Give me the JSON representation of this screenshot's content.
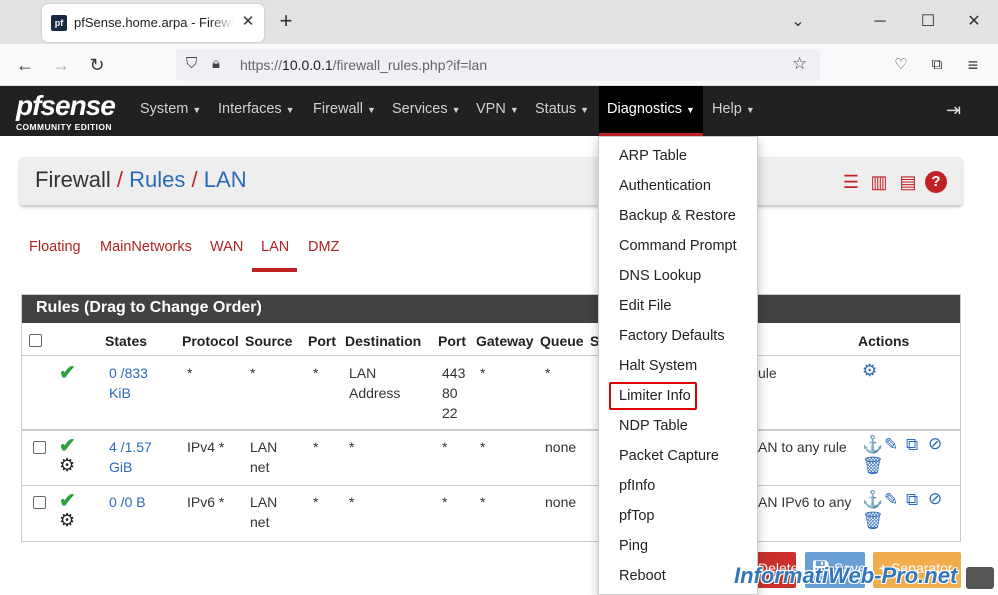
{
  "browser": {
    "tab_title": "pfSense.home.arpa - Firewall: Rules",
    "favicon_text": "pf",
    "url_prefix": "https://",
    "url_host": "10.0.0.1",
    "url_path": "/firewall_rules.php?if=lan"
  },
  "logo": {
    "main": "pfsense",
    "sub": "COMMUNITY EDITION"
  },
  "menu": [
    {
      "label": "System"
    },
    {
      "label": "Interfaces"
    },
    {
      "label": "Firewall"
    },
    {
      "label": "Services"
    },
    {
      "label": "VPN"
    },
    {
      "label": "Status"
    },
    {
      "label": "Diagnostics"
    },
    {
      "label": "Help"
    }
  ],
  "breadcrumb": {
    "part1": "Firewall",
    "sep": "/",
    "part2": "Rules",
    "part3": "LAN"
  },
  "subtabs": [
    "Floating",
    "MainNetworks",
    "WAN",
    "LAN",
    "DMZ"
  ],
  "panel_title": "Rules (Drag to Change Order)",
  "columns": [
    "States",
    "Protocol",
    "Source",
    "Port",
    "Destination",
    "Port",
    "Gateway",
    "Queue",
    "S",
    "Actions"
  ],
  "rows": [
    {
      "states1": "0 /833",
      "states2": "KiB",
      "protocol": "*",
      "source1": "*",
      "source2": "",
      "port": "*",
      "dest1": "LAN",
      "dest2": "Address",
      "dport1": "443",
      "dport2": "80",
      "dport3": "22",
      "gateway": "*",
      "queue": "*",
      "desc": "ule"
    },
    {
      "states1": "4 /1.57",
      "states2": "GiB",
      "protocol": "IPv4 *",
      "source1": "LAN",
      "source2": "net",
      "port": "*",
      "dest1": "*",
      "dest2": "",
      "dport1": "*",
      "dport2": "",
      "dport3": "",
      "gateway": "*",
      "queue": "none",
      "desc": "AN to any rule"
    },
    {
      "states1": "0 /0 B",
      "states2": "",
      "protocol": "IPv6 *",
      "source1": "LAN",
      "source2": "net",
      "port": "*",
      "dest1": "*",
      "dest2": "",
      "dport1": "*",
      "dport2": "",
      "dport3": "",
      "gateway": "*",
      "queue": "none",
      "desc": "AN IPv6 to any"
    }
  ],
  "dropdown": [
    "ARP Table",
    "Authentication",
    "Backup & Restore",
    "Command Prompt",
    "DNS Lookup",
    "Edit File",
    "Factory Defaults",
    "Halt System",
    "Limiter Info",
    "NDP Table",
    "Packet Capture",
    "pfInfo",
    "pfTop",
    "Ping",
    "Reboot"
  ],
  "buttons": {
    "delete": "Delete",
    "save": "Save",
    "separator": "Separator"
  },
  "watermark": "InformatiWeb-Pro.net",
  "colors": {
    "accent": "#c02125",
    "link": "#2a6ab8",
    "header": "#212121"
  }
}
